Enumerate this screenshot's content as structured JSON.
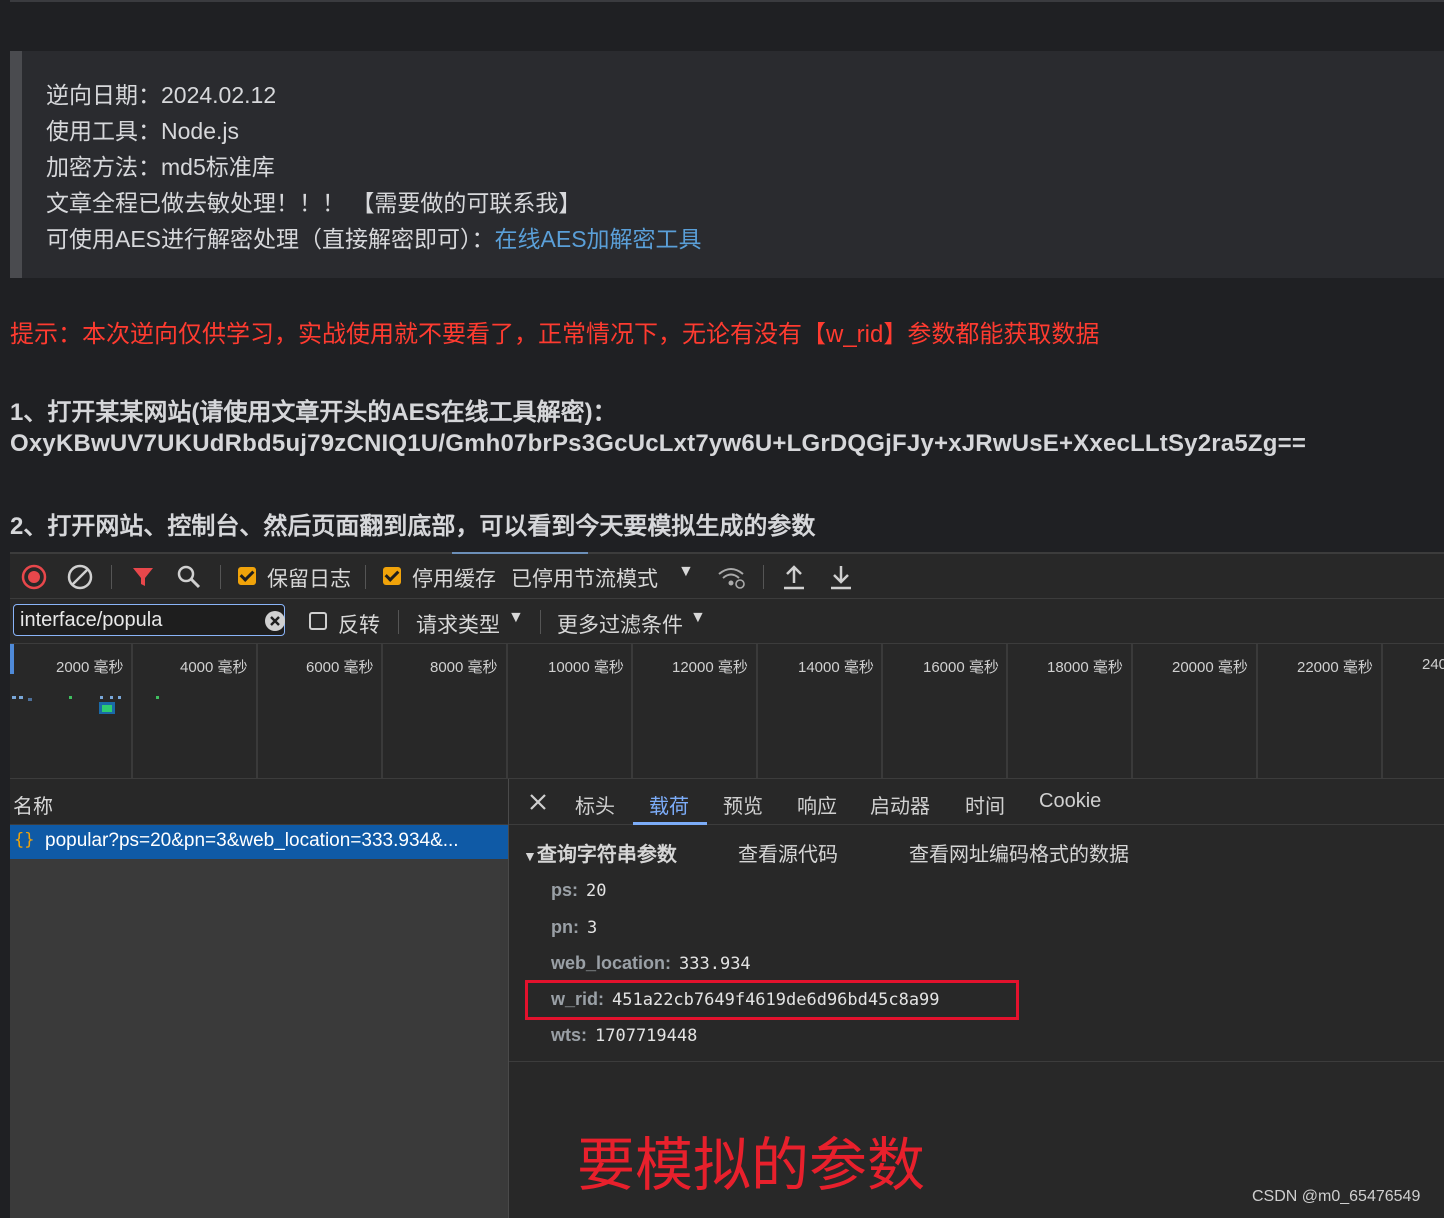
{
  "article": {
    "quote_lines": [
      "逆向日期：2024.02.12",
      "使用工具：Node.js",
      "加密方法：md5标准库",
      "文章全程已做去敏处理！！！   【需要做的可联系我】"
    ],
    "quote_last_prefix": "可使用AES进行解密处理（直接解密即可）：",
    "quote_link": "在线AES加解密工具",
    "tip": "提示：本次逆向仅供学习，实战使用就不要看了，正常情况下，无论有没有【w_rid】参数都能获取数据",
    "step1": "1、打开某某网站(请使用文章开头的AES在线工具解密)：",
    "cipher": "OxyKBwUV7UKUdRbd5uj79zCNIQ1U/Gmh07brPs3GcUcLxt7yw6U+LGrDQGjFJy+xJRwUsE+XxecLLtSy2ra5Zg==",
    "step2": "2、打开网站、控制台、然后页面翻到底部，可以看到今天要模拟生成的参数"
  },
  "devtools": {
    "toolbar": {
      "preserve_log": "保留日志",
      "disable_cache": "停用缓存",
      "throttle": "已停用节流模式"
    },
    "filter": {
      "value": "interface/popula",
      "invert": "反转",
      "request_type": "请求类型",
      "more_filters": "更多过滤条件"
    },
    "timeline_labels": [
      "2000 毫秒",
      "4000 毫秒",
      "6000 毫秒",
      "8000 毫秒",
      "10000 毫秒",
      "12000 毫秒",
      "14000 毫秒",
      "16000 毫秒",
      "18000 毫秒",
      "20000 毫秒",
      "22000 毫秒",
      "240"
    ],
    "requests": {
      "header": "名称",
      "rows": [
        "popular?ps=20&pn=3&web_location=333.934&..."
      ]
    },
    "detail_tabs": [
      "标头",
      "载荷",
      "预览",
      "响应",
      "启动器",
      "时间",
      "Cookie"
    ],
    "active_tab": "载荷",
    "payload": {
      "section_title": "查询字符串参数",
      "view_source": "查看源代码",
      "view_url_encoded": "查看网址编码格式的数据",
      "params": [
        {
          "key": "ps:",
          "value": "20"
        },
        {
          "key": "pn:",
          "value": "3"
        },
        {
          "key": "web_location:",
          "value": "333.934"
        },
        {
          "key": "w_rid:",
          "value": "451a22cb7649f4619de6d96bd45c8a99"
        },
        {
          "key": "wts:",
          "value": "1707719448"
        }
      ]
    }
  },
  "annotation": "要模拟的参数",
  "watermark": "CSDN @m0_65476549",
  "colors": {
    "tip_red": "#ff3b30",
    "link_blue": "#5a9fd8",
    "accent_orange": "#f0a30a",
    "selected_row": "#0f5aa6",
    "highlight_box": "#e3122d"
  }
}
